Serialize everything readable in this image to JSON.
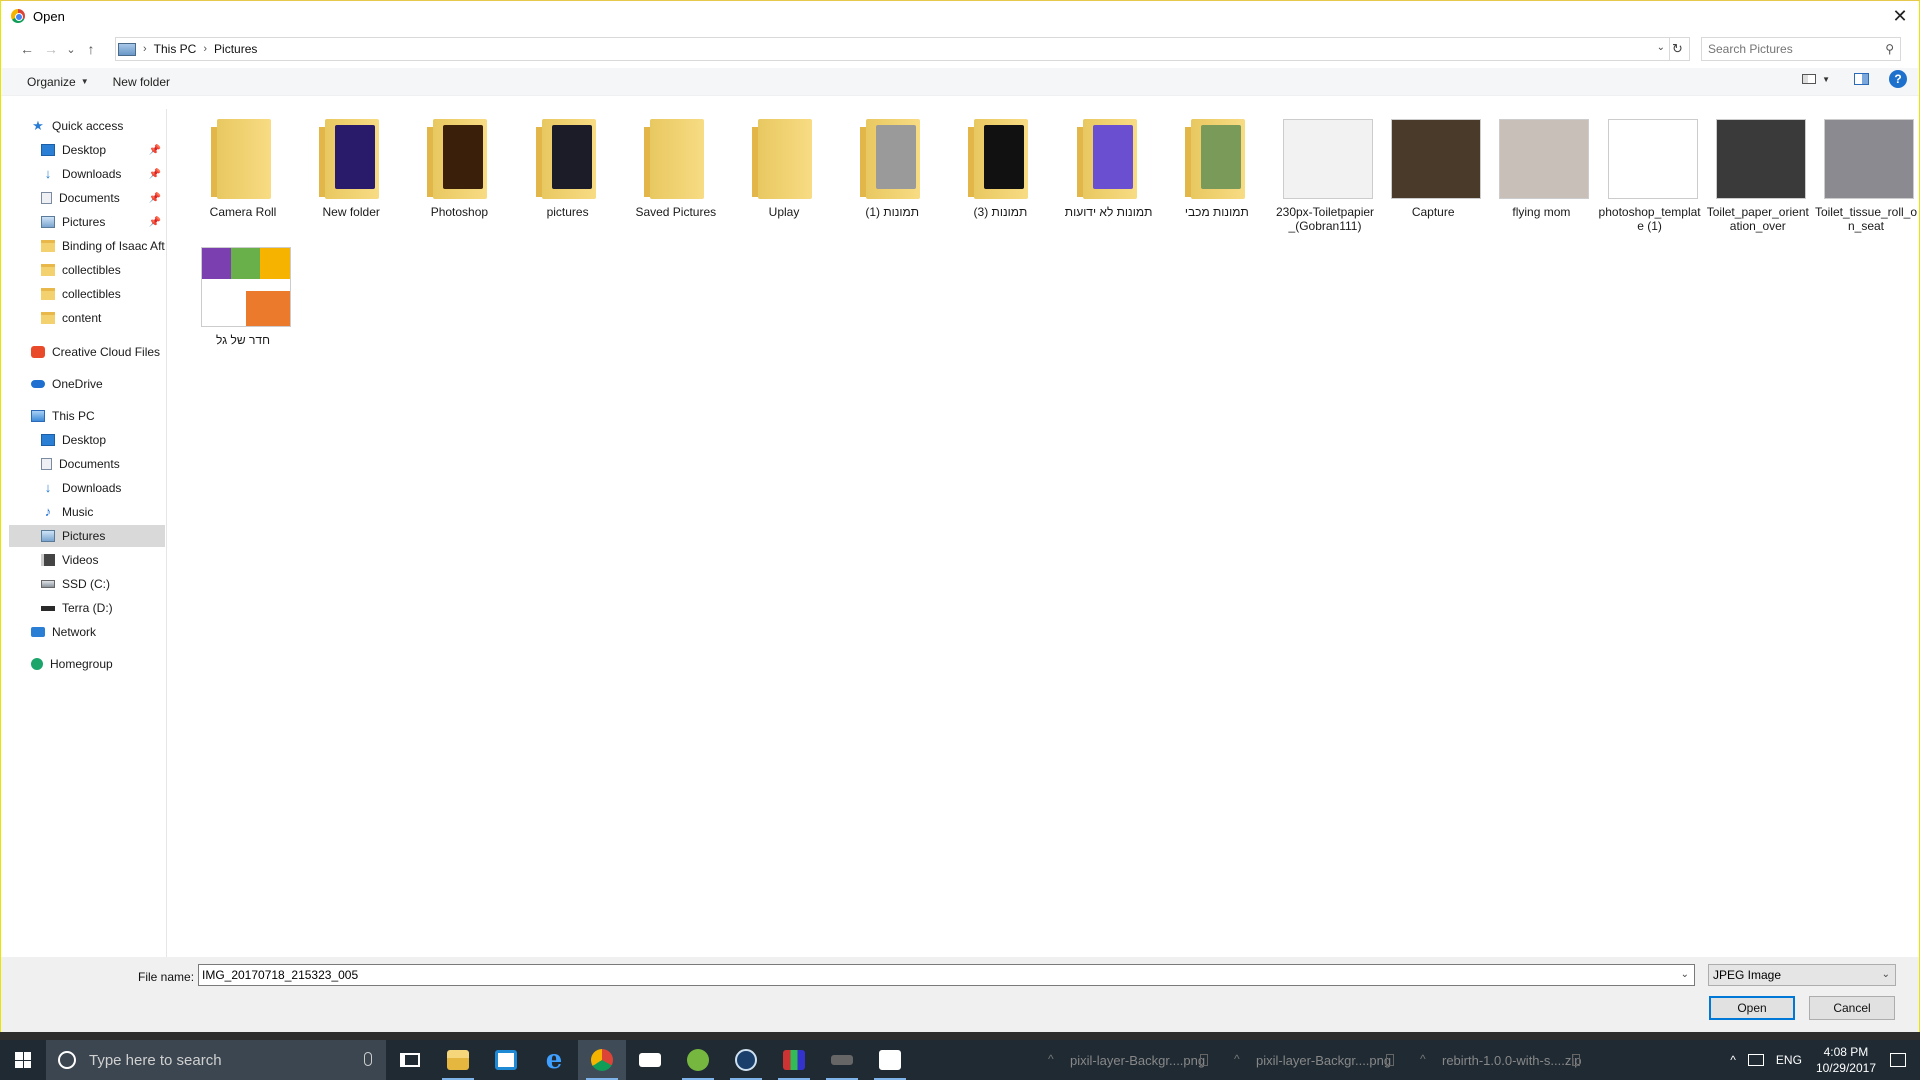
{
  "window": {
    "title": "Open",
    "close_glyph": "✕"
  },
  "address": {
    "crumbs": [
      "This PC",
      "Pictures"
    ],
    "separator": "›",
    "search_placeholder": "Search Pictures",
    "back_glyph": "←",
    "forward_glyph": "→",
    "recent_glyph": "⌄",
    "up_glyph": "↑",
    "dropdown_glyph": "⌄",
    "refresh_glyph": "↻",
    "search_glyph": "⚲"
  },
  "toolbar": {
    "organize_label": "Organize",
    "new_folder_label": "New folder",
    "caret_glyph": "▼",
    "help_glyph": "?"
  },
  "nav": {
    "quick_access": "Quick access",
    "qa_items": [
      "Desktop",
      "Downloads",
      "Documents",
      "Pictures",
      "Binding of Isaac Aft",
      "collectibles",
      "collectibles",
      "content"
    ],
    "pin_glyph": "📌",
    "creative_cloud": "Creative Cloud Files",
    "onedrive": "OneDrive",
    "this_pc": "This PC",
    "pc_items": [
      "Desktop",
      "Documents",
      "Downloads",
      "Music",
      "Pictures",
      "Videos",
      "SSD (C:)",
      "Terra (D:)"
    ],
    "network": "Network",
    "homegroup": "Homegroup",
    "icons": {
      "star": "★",
      "download_arrow": "↓",
      "music_note": "♪"
    }
  },
  "items": [
    {
      "label": "Camera Roll",
      "kind": "folder"
    },
    {
      "label": "New folder",
      "kind": "folder-colored",
      "color": "#2a1a6a"
    },
    {
      "label": "Photoshop",
      "kind": "folder-colored",
      "color": "#3a1f0a"
    },
    {
      "label": "pictures",
      "kind": "folder-colored",
      "color": "#1c1c28"
    },
    {
      "label": "Saved Pictures",
      "kind": "folder"
    },
    {
      "label": "Uplay",
      "kind": "folder"
    },
    {
      "label": "תמונות (1)",
      "kind": "folder-colored",
      "color": "#9a9a9a"
    },
    {
      "label": "תמונות (3)",
      "kind": "folder-colored",
      "color": "#111111"
    },
    {
      "label": "תמונות לא ידועות",
      "kind": "folder-colored",
      "color": "#6a4fd0"
    },
    {
      "label": "תמונות מכבי",
      "kind": "folder-colored",
      "color": "#7a9a5a"
    },
    {
      "label": "230px-Toiletpapier_(Gobran111)",
      "kind": "photo",
      "color": "#f2f2f2"
    },
    {
      "label": "Capture",
      "kind": "photo",
      "color": "#4a3a2a"
    },
    {
      "label": "flying mom",
      "kind": "photo",
      "color": "#c8c0b8"
    },
    {
      "label": "photoshop_template (1)",
      "kind": "photo",
      "color": "#ffffff"
    },
    {
      "label": "Toilet_paper_orientation_over",
      "kind": "photo",
      "color": "#3a3a3a"
    },
    {
      "label": "Toilet_tissue_roll_on_seat",
      "kind": "photo",
      "color": "#8a8a90"
    },
    {
      "label": "חדר של גל",
      "kind": "photo-grid",
      "color": "#ffffff"
    }
  ],
  "bottom": {
    "file_name_label": "File name:",
    "file_name_value": "IMG_20170718_215323_005",
    "file_type": "JPEG Image",
    "open_label": "Open",
    "cancel_label": "Cancel",
    "dropdown_glyph": "⌄"
  },
  "taskbar": {
    "search_placeholder": "Type here to search",
    "downloads": [
      "pixil-layer-Backgr....png",
      "pixil-layer-Backgr....png",
      "rebirth-1.0.0-with-s....zip"
    ],
    "lang": "ENG",
    "time": "4:08 PM",
    "date": "10/29/2017",
    "tray_caret": "^",
    "edge_glyph": "e"
  },
  "colors": {
    "accent": "#0078d7",
    "selected_nav": "#d9d9d9",
    "taskbar": "#1f2a33"
  }
}
